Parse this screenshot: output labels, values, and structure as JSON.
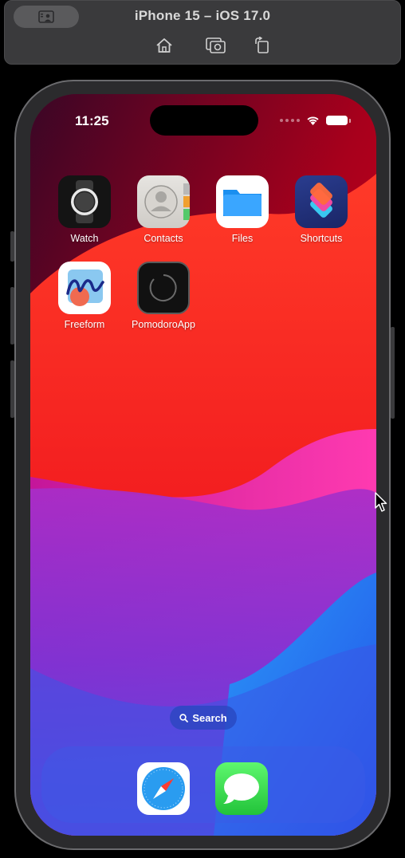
{
  "simulator": {
    "title": "iPhone 15 – iOS 17.0",
    "toolbar": [
      {
        "icon": "home-icon"
      },
      {
        "icon": "screenshot-icon"
      },
      {
        "icon": "rotate-icon"
      }
    ]
  },
  "status_bar": {
    "time": "11:25"
  },
  "home_screen": {
    "apps": [
      {
        "label": "Watch",
        "icon": "watch-icon"
      },
      {
        "label": "Contacts",
        "icon": "contacts-icon"
      },
      {
        "label": "Files",
        "icon": "files-icon"
      },
      {
        "label": "Shortcuts",
        "icon": "shortcuts-icon"
      },
      {
        "label": "Freeform",
        "icon": "freeform-icon"
      },
      {
        "label": "PomodoroApp",
        "icon": "pomodoro-icon"
      }
    ],
    "search_label": "Search"
  },
  "dock": {
    "apps": [
      {
        "icon": "safari-icon"
      },
      {
        "icon": "messages-icon"
      }
    ]
  },
  "colors": {
    "sim_bar": "#3a3a3c",
    "wallpaper_red": "#f5201e",
    "wallpaper_purple": "#8f2fd4",
    "wallpaper_blue": "#2a62f0"
  }
}
